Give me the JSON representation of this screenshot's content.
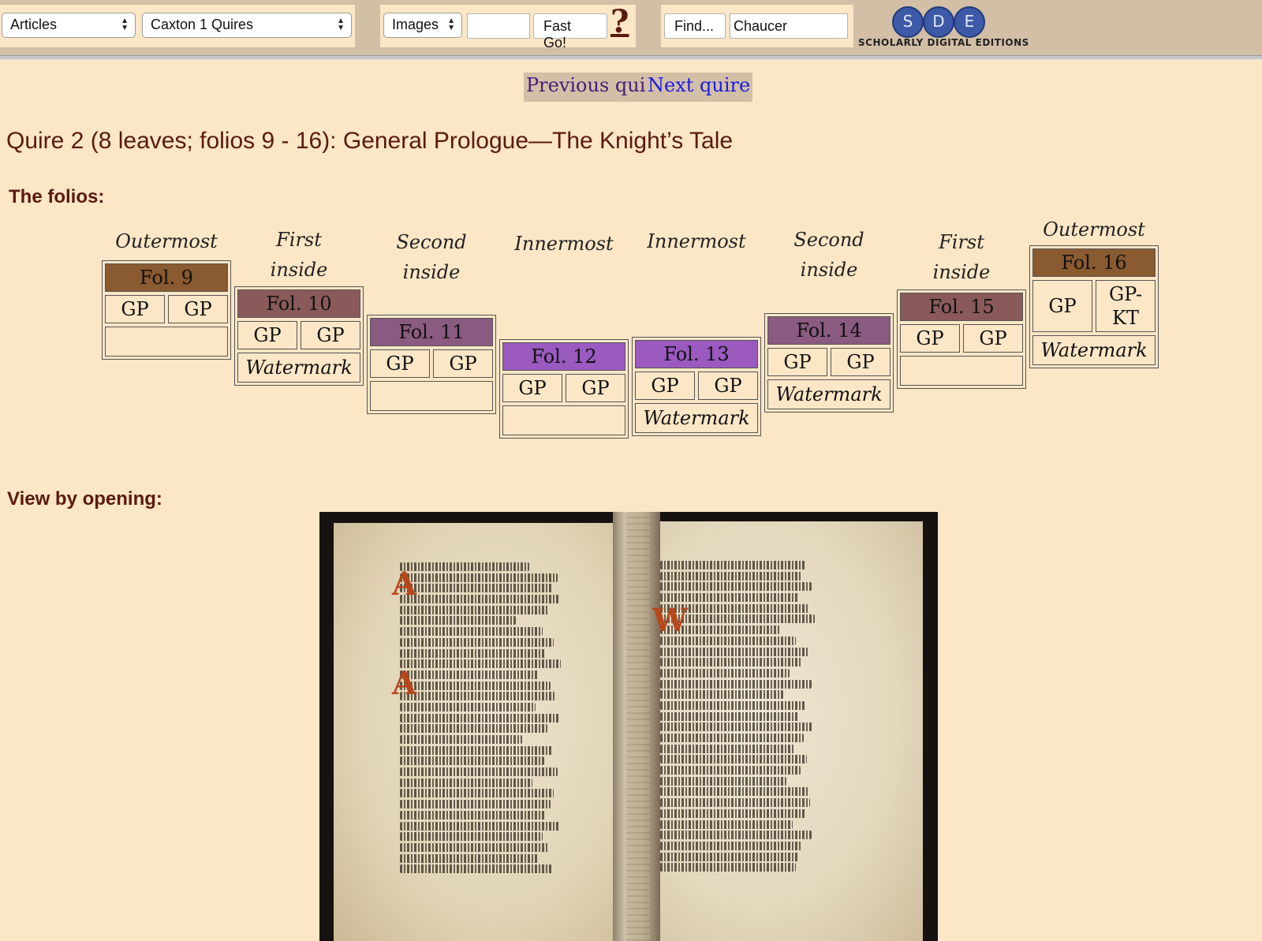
{
  "toolbar": {
    "articles_select": "Articles",
    "collection_select": "Caxton 1 Quires",
    "images_select": "Images",
    "page_input": "",
    "fast_go": "Fast Go!",
    "help": "?",
    "find_button": "Find...",
    "find_input": "Chaucer",
    "logo": {
      "letters": [
        "S",
        "D",
        "E"
      ],
      "tagline": "SCHOLARLY DIGITAL EDITIONS"
    }
  },
  "nav": {
    "previous": "Previous quire",
    "next": "Next quire"
  },
  "title": "Quire 2 (8 leaves; folios 9 - 16): General Prologue—The Knight’s Tale",
  "folios_heading": "The folios:",
  "folios": [
    {
      "position": "Outermost",
      "label": "Fol. 9",
      "cells": [
        "GP",
        "GP"
      ],
      "footer": "",
      "color": "#8a5a30"
    },
    {
      "position": "First inside",
      "label": "Fol. 10",
      "cells": [
        "GP",
        "GP"
      ],
      "footer": "Watermark",
      "color": "#8a5a5a"
    },
    {
      "position": "Second inside",
      "label": "Fol. 11",
      "cells": [
        "GP",
        "GP"
      ],
      "footer": "",
      "color": "#8a5a80"
    },
    {
      "position": "Innermost",
      "label": "Fol. 12",
      "cells": [
        "GP",
        "GP"
      ],
      "footer": "",
      "color": "#9a5ac0"
    },
    {
      "position": "Innermost",
      "label": "Fol. 13",
      "cells": [
        "GP",
        "GP"
      ],
      "footer": "Watermark",
      "color": "#9a5ac0"
    },
    {
      "position": "Second inside",
      "label": "Fol. 14",
      "cells": [
        "GP",
        "GP"
      ],
      "footer": "Watermark",
      "color": "#8a5a80"
    },
    {
      "position": "First inside",
      "label": "Fol. 15",
      "cells": [
        "GP",
        "GP"
      ],
      "footer": "",
      "color": "#8a5a5a"
    },
    {
      "position": "Outermost",
      "label": "Fol. 16",
      "cells": [
        "GP",
        "GP-KT"
      ],
      "footer": "Watermark",
      "color": "#8a5a30"
    }
  ],
  "opening_heading": "View by opening:"
}
